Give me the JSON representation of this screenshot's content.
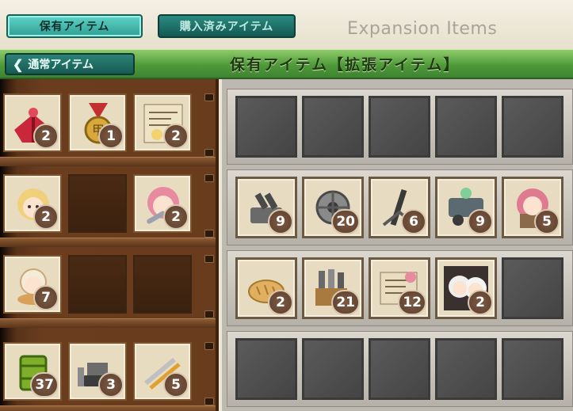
{
  "tabs": {
    "owned_label": "保有アイテム",
    "purchased_label": "購入済みアイテム"
  },
  "header": {
    "expansion_title": "Expansion Items",
    "back_label": "通常アイテム",
    "section_title": "保有アイテム【拡張アイテム】"
  },
  "colors": {
    "tab_active": "#3fb5aa",
    "tab_inactive": "#1d6d64",
    "title_bar": "#5aa542",
    "count_badge": "#6b4a36",
    "wood": "#6b3d1f",
    "empty_slot": "#4f4f4f"
  },
  "shelf": {
    "rows": [
      {
        "items": [
          {
            "icon": "ribbon-gift-icon",
            "count": "2"
          },
          {
            "icon": "medal-icon",
            "count": "1"
          },
          {
            "icon": "document-map-icon",
            "count": "2"
          }
        ]
      },
      {
        "items": [
          {
            "icon": "blonde-girl-icon",
            "count": "2"
          },
          null,
          {
            "icon": "repair-girl-icon",
            "count": "2"
          }
        ]
      },
      {
        "items": [
          {
            "icon": "food-girl-icon",
            "count": "7"
          },
          null,
          null
        ]
      },
      {
        "items": [
          {
            "icon": "oil-drum-icon",
            "count": "37"
          },
          {
            "icon": "bulldozer-icon",
            "count": "3"
          },
          {
            "icon": "tools-icon",
            "count": "5"
          }
        ]
      }
    ]
  },
  "grid": {
    "rows": [
      {
        "items": [
          null,
          null,
          null,
          null,
          null
        ]
      },
      {
        "items": [
          {
            "icon": "gun-turret-icon",
            "count": "9"
          },
          {
            "icon": "turbine-icon",
            "count": "20"
          },
          {
            "icon": "mortar-icon",
            "count": "6"
          },
          {
            "icon": "machinery-fairy-icon",
            "count": "9"
          },
          {
            "icon": "pink-hair-girl-icon",
            "count": "5"
          }
        ]
      },
      {
        "items": [
          {
            "icon": "bread-icon",
            "count": "2"
          },
          {
            "icon": "building-materials-icon",
            "count": "21"
          },
          {
            "icon": "blueprint-icon",
            "count": "12"
          },
          {
            "icon": "white-hair-girls-icon",
            "count": "2"
          },
          null
        ]
      },
      {
        "items": [
          null,
          null,
          null,
          null,
          null
        ]
      }
    ]
  }
}
